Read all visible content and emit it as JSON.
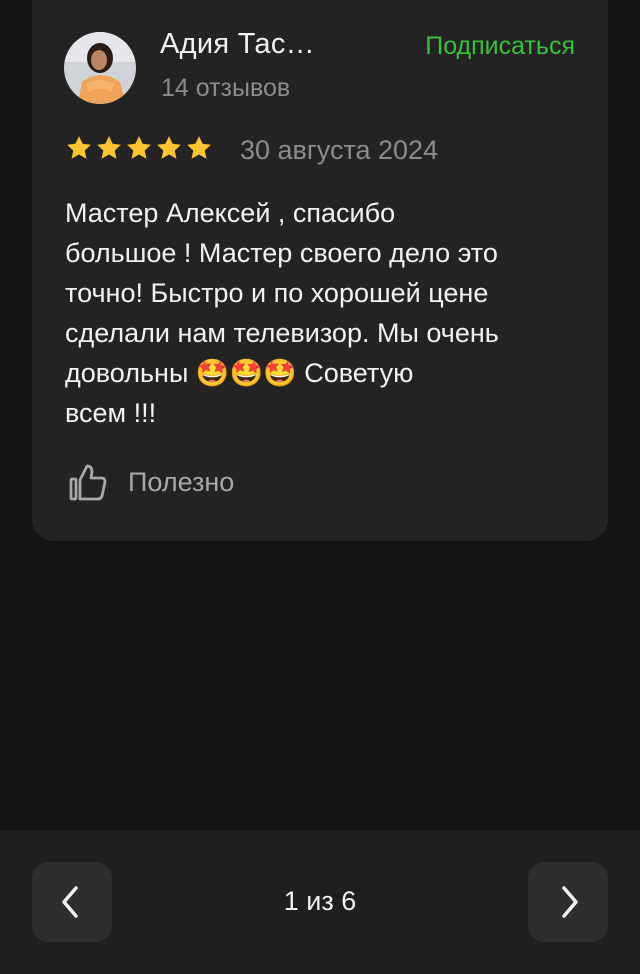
{
  "review": {
    "author_name": "Адия Тас…",
    "review_count": "14 отзывов",
    "subscribe_label": "Подписаться",
    "rating": 5,
    "max_rating": 5,
    "date": "30 августа 2024",
    "text": "Мастер Алексей , спасибо\nбольшое ! Мастер своего дело это\nточно! Быстро и по хорошей цене\nсделали нам телевизор. Мы очень\nдовольны 🤩🤩🤩 Советую\nвсем !!!",
    "helpful_label": "Полезно"
  },
  "pager": {
    "indicator": "1 из 6"
  },
  "icons": {
    "star": "star-icon",
    "thumbs_up": "thumbs-up-icon",
    "prev": "chevron-left-icon",
    "next": "chevron-right-icon"
  },
  "colors": {
    "background": "#141414",
    "card": "#232323",
    "accent_green": "#39c13c",
    "star": "#fbc531",
    "text_primary": "#f2f2f2",
    "text_secondary": "#8c8c8c"
  }
}
